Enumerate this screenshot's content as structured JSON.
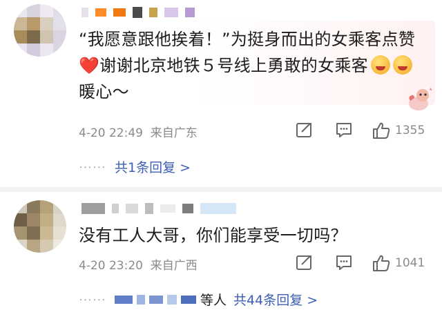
{
  "comments": [
    {
      "text_line1": "“我愿意跟他挨着！”为挺身而出的女乘客点赞",
      "text_line2": "谢谢北京地铁５号线上勇敢的女乘客",
      "text_line3": "暖心～",
      "heart_emoji": "❤️",
      "time": "4-20 22:49",
      "source": "来自广东",
      "likes": "1355",
      "replies_label": "共1条回复 >"
    },
    {
      "text_line1": "没有工人大哥，你们能享受一切吗？",
      "time": "4-20 23:20",
      "source": "来自广西",
      "likes": "1041",
      "repliers_suffix": "等人",
      "replies_label": "共44条回复 >"
    }
  ],
  "icons": {
    "share": "share-icon",
    "comment": "comment-icon",
    "like": "thumbs-up-icon",
    "face": "heart-eyes-face-emoji",
    "sticker": "cute-sticker"
  },
  "colors": {
    "link": "#3b5eb6",
    "meta": "#8a8a8a",
    "divider": "#f2f2f2",
    "heart": "#e53935"
  }
}
